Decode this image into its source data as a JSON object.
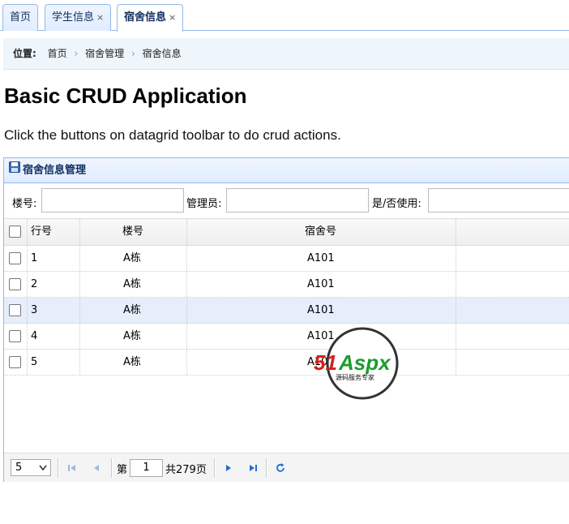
{
  "tabs": [
    {
      "label": "首页",
      "closable": false,
      "active": false
    },
    {
      "label": "学生信息",
      "closable": true,
      "active": false
    },
    {
      "label": "宿舍信息",
      "closable": true,
      "active": true
    }
  ],
  "close_glyph": "×",
  "breadcrumb": {
    "label": "位置:",
    "items": [
      "首页",
      "宿舍管理",
      "宿舍信息"
    ],
    "separator": "›"
  },
  "page": {
    "title": "Basic CRUD Application",
    "description": "Click the buttons on datagrid toolbar to do crud actions."
  },
  "panel": {
    "title": "宿舍信息管理",
    "icon": "save-icon"
  },
  "search": {
    "building_label": "楼号:",
    "building_value": "",
    "manager_label": "管理员:",
    "manager_value": "",
    "in_use_label": "是/否使用:",
    "in_use_value": ""
  },
  "grid": {
    "columns": [
      "行号",
      "楼号",
      "宿舍号"
    ],
    "rows": [
      {
        "row": "1",
        "building": "A栋",
        "room": "A101",
        "selected": false
      },
      {
        "row": "2",
        "building": "A栋",
        "room": "A101",
        "selected": false
      },
      {
        "row": "3",
        "building": "A栋",
        "room": "A101",
        "selected": true
      },
      {
        "row": "4",
        "building": "A栋",
        "room": "A101",
        "selected": false
      },
      {
        "row": "5",
        "building": "A栋",
        "room": "A101",
        "selected": false
      }
    ]
  },
  "pager": {
    "page_size": "5",
    "page_prefix": "第",
    "current_page": "1",
    "total_text": "共279页",
    "icons": [
      "first-page-icon",
      "prev-page-icon",
      "next-page-icon",
      "last-page-icon",
      "refresh-icon"
    ],
    "accent_color": "#1e6fd0"
  },
  "watermark": {
    "brand": "51Aspx",
    "tagline": "源码服务专家"
  }
}
